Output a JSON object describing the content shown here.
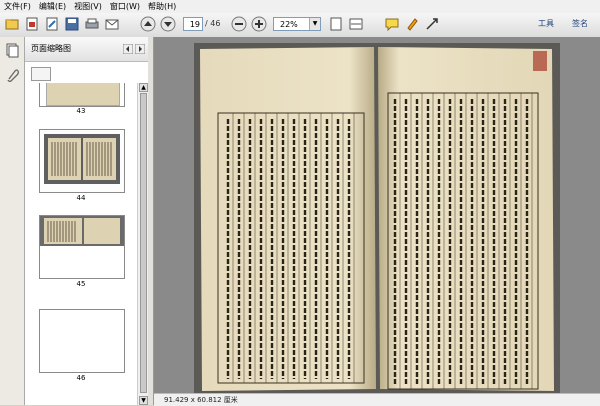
{
  "menu": [
    "文件(F)",
    "编辑(E)",
    "视图(V)",
    "窗口(W)",
    "帮助(H)"
  ],
  "toolbar": {
    "current_page": "19",
    "page_total": "/ 46",
    "zoom": "22%",
    "tools_label": "工具",
    "sign_label": "签名"
  },
  "panel": {
    "title": "页面缩略图",
    "thumbs": [
      {
        "label": "43"
      },
      {
        "label": "44"
      },
      {
        "label": "45"
      },
      {
        "label": "46"
      }
    ]
  },
  "status": {
    "dimensions": "91.429 x 60.812 厘米"
  },
  "colors": {
    "paper": "#ece2c6",
    "paper_shadow": "#cfc3a0",
    "ink": "#2a2418",
    "doc_bg": "#8a8a8a",
    "accent": "#1a3f7a"
  }
}
